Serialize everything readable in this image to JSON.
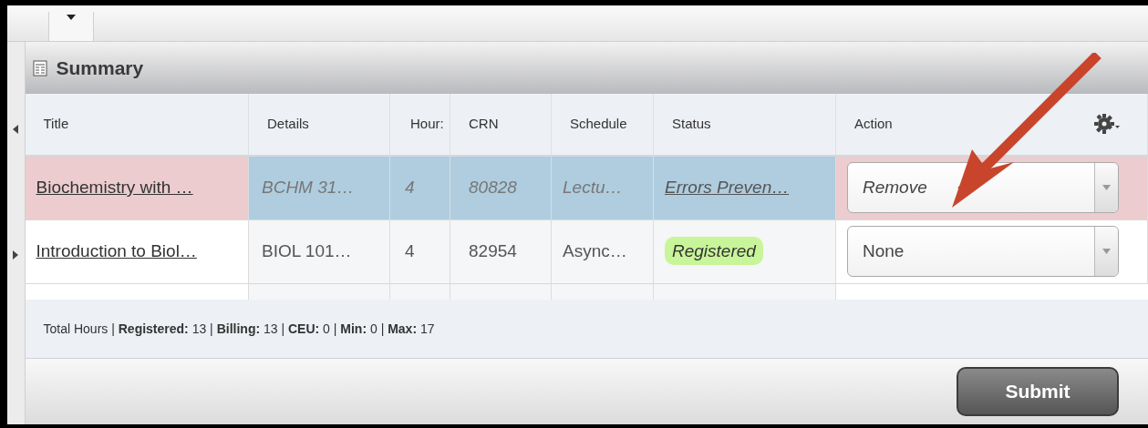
{
  "panel": {
    "title": "Summary"
  },
  "table": {
    "columns": [
      "Title",
      "Details",
      "Hour:",
      "CRN",
      "Schedule",
      "Status",
      "Action"
    ],
    "rows": [
      {
        "selected": true,
        "error": true,
        "title": "Biochemistry with …",
        "details": "BCHM 31…",
        "hours": "4",
        "crn": "80828",
        "schedule": "Lectu…",
        "status": {
          "kind": "link",
          "text": "Errors Preven…"
        },
        "action": "Remove"
      },
      {
        "selected": false,
        "error": false,
        "title": "Introduction to Biol…",
        "details": "BIOL 101…",
        "hours": "4",
        "crn": "82954",
        "schedule": "Async…",
        "status": {
          "kind": "badge",
          "text": "Registered"
        },
        "action": "None"
      }
    ]
  },
  "footer": "Total Hours | **Registered:** 13 | **Billing:** 13 | **CEU:** 0 | **Min:** 0 | **Max:** 17",
  "buttons": [
    "Submit"
  ]
}
